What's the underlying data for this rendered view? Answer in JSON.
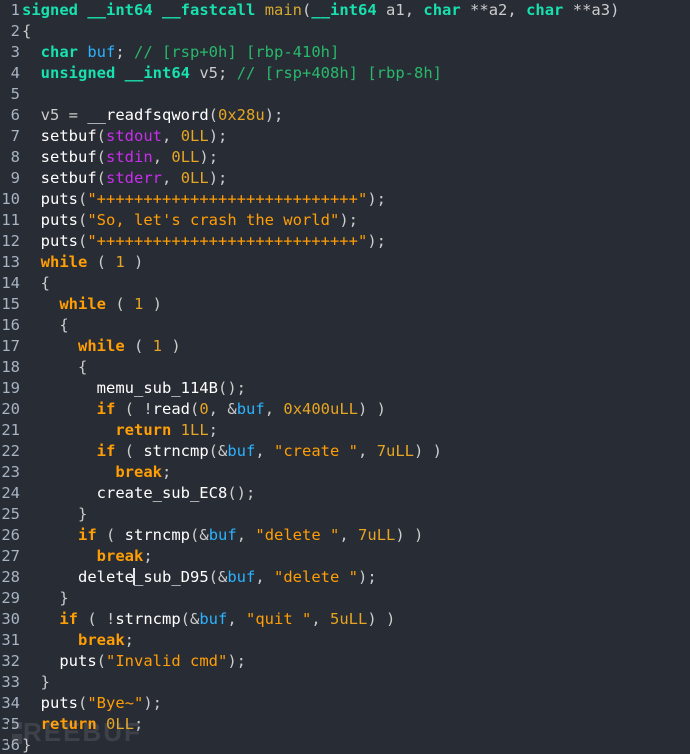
{
  "language": "c",
  "watermark": "REEBUF",
  "lines": [
    {
      "n": 1,
      "tokens": [
        {
          "t": "signed",
          "c": "kw-type"
        },
        {
          "t": " "
        },
        {
          "t": "__int64",
          "c": "kw-type"
        },
        {
          "t": " "
        },
        {
          "t": "__fastcall",
          "c": "kw-type"
        },
        {
          "t": " "
        },
        {
          "t": "main",
          "c": "fn-decl"
        },
        {
          "t": "(",
          "c": "paren"
        },
        {
          "t": "__int64",
          "c": "kw-type"
        },
        {
          "t": " "
        },
        {
          "t": "a1",
          "c": "ident"
        },
        {
          "t": ", "
        },
        {
          "t": "char",
          "c": "kw-type"
        },
        {
          "t": " "
        },
        {
          "t": "**",
          "c": "op"
        },
        {
          "t": "a2",
          "c": "ident"
        },
        {
          "t": ", "
        },
        {
          "t": "char",
          "c": "kw-type"
        },
        {
          "t": " "
        },
        {
          "t": "**",
          "c": "op"
        },
        {
          "t": "a3",
          "c": "ident"
        },
        {
          "t": ")",
          "c": "paren"
        }
      ]
    },
    {
      "n": 2,
      "tokens": [
        {
          "t": "{",
          "c": "brace"
        }
      ]
    },
    {
      "n": 3,
      "tokens": [
        {
          "t": "  "
        },
        {
          "t": "char",
          "c": "kw-type"
        },
        {
          "t": " "
        },
        {
          "t": "buf",
          "c": "var-local"
        },
        {
          "t": "; "
        },
        {
          "t": "// [rsp+0h] [rbp-410h]",
          "c": "comment"
        }
      ]
    },
    {
      "n": 4,
      "tokens": [
        {
          "t": "  "
        },
        {
          "t": "unsigned",
          "c": "kw-type"
        },
        {
          "t": " "
        },
        {
          "t": "__int64",
          "c": "kw-type"
        },
        {
          "t": " "
        },
        {
          "t": "v5",
          "c": "ident"
        },
        {
          "t": "; "
        },
        {
          "t": "// [rsp+408h] [rbp-8h]",
          "c": "comment"
        }
      ]
    },
    {
      "n": 5,
      "tokens": [
        {
          "t": " "
        }
      ]
    },
    {
      "n": 6,
      "tokens": [
        {
          "t": "  "
        },
        {
          "t": "v5",
          "c": "ident"
        },
        {
          "t": " = "
        },
        {
          "t": "__readfsqword",
          "c": "fn-call"
        },
        {
          "t": "(",
          "c": "paren"
        },
        {
          "t": "0x28u",
          "c": "num-hex"
        },
        {
          "t": ");",
          "c": "paren"
        }
      ]
    },
    {
      "n": 7,
      "tokens": [
        {
          "t": "  "
        },
        {
          "t": "setbuf",
          "c": "fn-lib"
        },
        {
          "t": "(",
          "c": "paren"
        },
        {
          "t": "stdout",
          "c": "var-std"
        },
        {
          "t": ", "
        },
        {
          "t": "0LL",
          "c": "num"
        },
        {
          "t": ");",
          "c": "paren"
        }
      ]
    },
    {
      "n": 8,
      "tokens": [
        {
          "t": "  "
        },
        {
          "t": "setbuf",
          "c": "fn-lib"
        },
        {
          "t": "(",
          "c": "paren"
        },
        {
          "t": "stdin",
          "c": "var-std"
        },
        {
          "t": ", "
        },
        {
          "t": "0LL",
          "c": "num"
        },
        {
          "t": ");",
          "c": "paren"
        }
      ]
    },
    {
      "n": 9,
      "tokens": [
        {
          "t": "  "
        },
        {
          "t": "setbuf",
          "c": "fn-lib"
        },
        {
          "t": "(",
          "c": "paren"
        },
        {
          "t": "stderr",
          "c": "var-std"
        },
        {
          "t": ", "
        },
        {
          "t": "0LL",
          "c": "num"
        },
        {
          "t": ");",
          "c": "paren"
        }
      ]
    },
    {
      "n": 10,
      "tokens": [
        {
          "t": "  "
        },
        {
          "t": "puts",
          "c": "fn-lib"
        },
        {
          "t": "(",
          "c": "paren"
        },
        {
          "t": "\"++++++++++++++++++++++++++++\"",
          "c": "str"
        },
        {
          "t": ");",
          "c": "paren"
        }
      ]
    },
    {
      "n": 11,
      "tokens": [
        {
          "t": "  "
        },
        {
          "t": "puts",
          "c": "fn-lib"
        },
        {
          "t": "(",
          "c": "paren"
        },
        {
          "t": "\"So, let's crash the world\"",
          "c": "str"
        },
        {
          "t": ");",
          "c": "paren"
        }
      ]
    },
    {
      "n": 12,
      "tokens": [
        {
          "t": "  "
        },
        {
          "t": "puts",
          "c": "fn-lib"
        },
        {
          "t": "(",
          "c": "paren"
        },
        {
          "t": "\"++++++++++++++++++++++++++++\"",
          "c": "str"
        },
        {
          "t": ");",
          "c": "paren"
        }
      ]
    },
    {
      "n": 13,
      "tokens": [
        {
          "t": "  "
        },
        {
          "t": "while",
          "c": "kw-ctrl"
        },
        {
          "t": " ( "
        },
        {
          "t": "1",
          "c": "num"
        },
        {
          "t": " )"
        }
      ]
    },
    {
      "n": 14,
      "tokens": [
        {
          "t": "  "
        },
        {
          "t": "{",
          "c": "brace"
        }
      ]
    },
    {
      "n": 15,
      "tokens": [
        {
          "t": "    "
        },
        {
          "t": "while",
          "c": "kw-ctrl"
        },
        {
          "t": " ( "
        },
        {
          "t": "1",
          "c": "num"
        },
        {
          "t": " )"
        }
      ]
    },
    {
      "n": 16,
      "tokens": [
        {
          "t": "    "
        },
        {
          "t": "{",
          "c": "brace"
        }
      ]
    },
    {
      "n": 17,
      "tokens": [
        {
          "t": "      "
        },
        {
          "t": "while",
          "c": "kw-ctrl"
        },
        {
          "t": " ( "
        },
        {
          "t": "1",
          "c": "num"
        },
        {
          "t": " )"
        }
      ]
    },
    {
      "n": 18,
      "tokens": [
        {
          "t": "      "
        },
        {
          "t": "{",
          "c": "brace"
        }
      ]
    },
    {
      "n": 19,
      "tokens": [
        {
          "t": "        "
        },
        {
          "t": "memu_sub_114B",
          "c": "fn-call"
        },
        {
          "t": "();",
          "c": "paren"
        }
      ]
    },
    {
      "n": 20,
      "tokens": [
        {
          "t": "        "
        },
        {
          "t": "if",
          "c": "kw-ctrl"
        },
        {
          "t": " ( !"
        },
        {
          "t": "read",
          "c": "fn-lib"
        },
        {
          "t": "(",
          "c": "paren"
        },
        {
          "t": "0",
          "c": "num"
        },
        {
          "t": ", "
        },
        {
          "t": "&",
          "c": "amp"
        },
        {
          "t": "buf",
          "c": "var-local"
        },
        {
          "t": ", "
        },
        {
          "t": "0x400uLL",
          "c": "num-hex"
        },
        {
          "t": ") )",
          "c": "paren"
        }
      ]
    },
    {
      "n": 21,
      "tokens": [
        {
          "t": "          "
        },
        {
          "t": "return",
          "c": "kw-ctrl"
        },
        {
          "t": " "
        },
        {
          "t": "1LL",
          "c": "num"
        },
        {
          "t": ";"
        }
      ]
    },
    {
      "n": 22,
      "tokens": [
        {
          "t": "        "
        },
        {
          "t": "if",
          "c": "kw-ctrl"
        },
        {
          "t": " ( "
        },
        {
          "t": "strncmp",
          "c": "fn-lib"
        },
        {
          "t": "(",
          "c": "paren"
        },
        {
          "t": "&",
          "c": "amp"
        },
        {
          "t": "buf",
          "c": "var-local"
        },
        {
          "t": ", "
        },
        {
          "t": "\"create \"",
          "c": "str"
        },
        {
          "t": ", "
        },
        {
          "t": "7uLL",
          "c": "num"
        },
        {
          "t": ") )",
          "c": "paren"
        }
      ]
    },
    {
      "n": 23,
      "tokens": [
        {
          "t": "          "
        },
        {
          "t": "break",
          "c": "kw-ctrl"
        },
        {
          "t": ";"
        }
      ]
    },
    {
      "n": 24,
      "tokens": [
        {
          "t": "        "
        },
        {
          "t": "create_sub_EC8",
          "c": "fn-call"
        },
        {
          "t": "();",
          "c": "paren"
        }
      ]
    },
    {
      "n": 25,
      "tokens": [
        {
          "t": "      "
        },
        {
          "t": "}",
          "c": "brace"
        }
      ]
    },
    {
      "n": 26,
      "tokens": [
        {
          "t": "      "
        },
        {
          "t": "if",
          "c": "kw-ctrl"
        },
        {
          "t": " ( "
        },
        {
          "t": "strncmp",
          "c": "fn-lib"
        },
        {
          "t": "(",
          "c": "paren"
        },
        {
          "t": "&",
          "c": "amp"
        },
        {
          "t": "buf",
          "c": "var-local"
        },
        {
          "t": ", "
        },
        {
          "t": "\"delete \"",
          "c": "str"
        },
        {
          "t": ", "
        },
        {
          "t": "7uLL",
          "c": "num"
        },
        {
          "t": ") )",
          "c": "paren"
        }
      ]
    },
    {
      "n": 27,
      "tokens": [
        {
          "t": "        "
        },
        {
          "t": "break",
          "c": "kw-ctrl"
        },
        {
          "t": ";"
        }
      ]
    },
    {
      "n": 28,
      "tokens": [
        {
          "t": "      "
        },
        {
          "t": "delete",
          "c": "fn-call"
        },
        {
          "t": "",
          "cursor": true
        },
        {
          "t": "_sub_D95",
          "c": "fn-call"
        },
        {
          "t": "(",
          "c": "paren"
        },
        {
          "t": "&",
          "c": "amp"
        },
        {
          "t": "buf",
          "c": "var-local"
        },
        {
          "t": ", "
        },
        {
          "t": "\"delete \"",
          "c": "str"
        },
        {
          "t": ");",
          "c": "paren"
        }
      ]
    },
    {
      "n": 29,
      "tokens": [
        {
          "t": "    "
        },
        {
          "t": "}",
          "c": "brace"
        }
      ]
    },
    {
      "n": 30,
      "tokens": [
        {
          "t": "    "
        },
        {
          "t": "if",
          "c": "kw-ctrl"
        },
        {
          "t": " ( !"
        },
        {
          "t": "strncmp",
          "c": "fn-lib"
        },
        {
          "t": "(",
          "c": "paren"
        },
        {
          "t": "&",
          "c": "amp"
        },
        {
          "t": "buf",
          "c": "var-local"
        },
        {
          "t": ", "
        },
        {
          "t": "\"quit \"",
          "c": "str"
        },
        {
          "t": ", "
        },
        {
          "t": "5uLL",
          "c": "num"
        },
        {
          "t": ") )",
          "c": "paren"
        }
      ]
    },
    {
      "n": 31,
      "tokens": [
        {
          "t": "      "
        },
        {
          "t": "break",
          "c": "kw-ctrl"
        },
        {
          "t": ";"
        }
      ]
    },
    {
      "n": 32,
      "tokens": [
        {
          "t": "    "
        },
        {
          "t": "puts",
          "c": "fn-lib"
        },
        {
          "t": "(",
          "c": "paren"
        },
        {
          "t": "\"Invalid cmd\"",
          "c": "str"
        },
        {
          "t": ");",
          "c": "paren"
        }
      ]
    },
    {
      "n": 33,
      "tokens": [
        {
          "t": "  "
        },
        {
          "t": "}",
          "c": "brace"
        }
      ]
    },
    {
      "n": 34,
      "tokens": [
        {
          "t": "  "
        },
        {
          "t": "puts",
          "c": "fn-lib"
        },
        {
          "t": "(",
          "c": "paren"
        },
        {
          "t": "\"Bye~\"",
          "c": "str"
        },
        {
          "t": ");",
          "c": "paren"
        }
      ]
    },
    {
      "n": 35,
      "tokens": [
        {
          "t": "  "
        },
        {
          "t": "return",
          "c": "kw-ctrl"
        },
        {
          "t": " "
        },
        {
          "t": "0LL",
          "c": "num"
        },
        {
          "t": ";"
        }
      ]
    },
    {
      "n": 36,
      "tokens": [
        {
          "t": "}",
          "c": "brace"
        }
      ]
    }
  ]
}
